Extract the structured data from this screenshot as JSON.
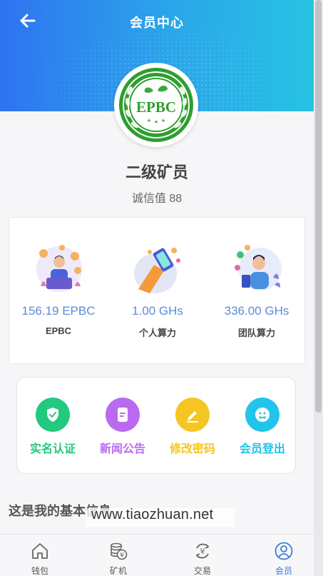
{
  "header": {
    "title": "会员中心",
    "back_icon": "arrow-left-icon"
  },
  "logo": {
    "text": "EPBC",
    "color": "#2e9e2e"
  },
  "member": {
    "level": "二级矿员",
    "credit": "诚信值 88"
  },
  "stats": [
    {
      "value": "156.19 EPBC",
      "label": "EPBC",
      "icon": "coins-person-illustration"
    },
    {
      "value": "1.00 GHs",
      "label": "个人算力",
      "icon": "phone-hand-illustration"
    },
    {
      "value": "336.00 GHs",
      "label": "团队算力",
      "icon": "team-person-illustration"
    }
  ],
  "actions": [
    {
      "label": "实名认证",
      "icon": "shield-check-icon",
      "color": "#22c97e"
    },
    {
      "label": "新闻公告",
      "icon": "document-icon",
      "color": "#b86bf0"
    },
    {
      "label": "修改密码",
      "icon": "edit-icon",
      "color": "#f5c621"
    },
    {
      "label": "会员登出",
      "icon": "smiley-logout-icon",
      "color": "#22c4ea"
    }
  ],
  "section": {
    "title": "这是我的基本信息"
  },
  "watermark": "www.tiaozhuan.net",
  "tabbar": [
    {
      "label": "钱包",
      "icon": "home-icon",
      "active": false
    },
    {
      "label": "矿机",
      "icon": "coin-stack-icon",
      "active": false
    },
    {
      "label": "交易",
      "icon": "exchange-icon",
      "active": false
    },
    {
      "label": "会员",
      "icon": "user-icon",
      "active": true
    }
  ],
  "colors": {
    "accent": "#3b7bd8",
    "stat_value": "#5b8bd8",
    "header_start": "#2f73f0",
    "header_end": "#27c3e2"
  }
}
